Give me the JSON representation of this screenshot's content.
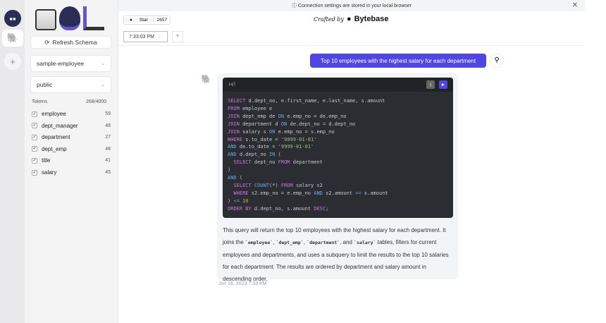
{
  "banner": {
    "text": "ⓘ Connection settings are stored in your local browser",
    "close": "✕"
  },
  "rail": {
    "add": "+"
  },
  "sidebar": {
    "logo": "SQL Chat",
    "refresh": "Refresh Schema",
    "database": "sample-employee",
    "schema": "public",
    "tokens_label": "Tokens",
    "tokens_value": "268/4000",
    "tables": [
      {
        "name": "employee",
        "tokens": "59"
      },
      {
        "name": "dept_manager",
        "tokens": "48"
      },
      {
        "name": "department",
        "tokens": "27"
      },
      {
        "name": "dept_emp",
        "tokens": "48"
      },
      {
        "name": "title",
        "tokens": "41"
      },
      {
        "name": "salary",
        "tokens": "45"
      }
    ]
  },
  "header": {
    "star": "Star",
    "star_count": "2657",
    "crafted": "Crafted by",
    "brand": "Bytebase"
  },
  "tabs": [
    {
      "label": "7:33:03 PM"
    }
  ],
  "chat": {
    "user_message": "Top 10 employees with the highest salary for each department",
    "code_lang": "sql",
    "code_lines": [
      [
        [
          "SELECT",
          "k"
        ],
        [
          " d.dept_no, e.first_name, e.last_name, s.amount",
          ""
        ]
      ],
      [
        [
          "FROM",
          "k"
        ],
        [
          " employee e",
          ""
        ]
      ],
      [
        [
          "JOIN",
          "k"
        ],
        [
          " dept_emp de ",
          ""
        ],
        [
          "ON",
          "o"
        ],
        [
          " e.emp_no = de.emp_no",
          ""
        ]
      ],
      [
        [
          "JOIN",
          "k"
        ],
        [
          " department d ",
          ""
        ],
        [
          "ON",
          "o"
        ],
        [
          " de.dept_no = d.dept_no",
          ""
        ]
      ],
      [
        [
          "JOIN",
          "k"
        ],
        [
          " salary s ",
          ""
        ],
        [
          "ON",
          "o"
        ],
        [
          " e.emp_no = s.emp_no",
          ""
        ]
      ],
      [
        [
          "WHERE",
          "k"
        ],
        [
          " s.to_date = ",
          ""
        ],
        [
          "'9999-01-01'",
          "s"
        ]
      ],
      [
        [
          "AND",
          "o"
        ],
        [
          " de.to_date = ",
          ""
        ],
        [
          "'9999-01-01'",
          "s"
        ]
      ],
      [
        [
          "AND",
          "o"
        ],
        [
          " d.dept_no ",
          ""
        ],
        [
          "IN",
          "o"
        ],
        [
          " (",
          ""
        ]
      ],
      [
        [
          "  SELECT",
          "k"
        ],
        [
          " dept_no ",
          ""
        ],
        [
          "FROM",
          "k"
        ],
        [
          " department",
          ""
        ]
      ],
      [
        [
          ")",
          ""
        ]
      ],
      [
        [
          "AND",
          "o"
        ],
        [
          " (",
          ""
        ]
      ],
      [
        [
          "  SELECT",
          "k"
        ],
        [
          " ",
          ""
        ],
        [
          "COUNT",
          "o"
        ],
        [
          "(*) ",
          ""
        ],
        [
          "FROM",
          "k"
        ],
        [
          " salary s2",
          ""
        ]
      ],
      [
        [
          "  WHERE",
          "k"
        ],
        [
          " s2.emp_no = e.emp_no ",
          ""
        ],
        [
          "AND",
          "o"
        ],
        [
          " s2.amount ",
          ""
        ],
        [
          ">=",
          "o"
        ],
        [
          " s.amount",
          ""
        ]
      ],
      [
        [
          ") ",
          ""
        ],
        [
          "<=",
          "o"
        ],
        [
          " ",
          ""
        ],
        [
          "10",
          "nm"
        ]
      ],
      [
        [
          "ORDER BY",
          "k"
        ],
        [
          " d.dept_no, s.amount ",
          ""
        ],
        [
          "DESC",
          "k"
        ],
        [
          ";",
          ""
        ]
      ]
    ],
    "explanation": [
      [
        "This query will return the top 10 employees with the highest salary for each department. It joins the ",
        ""
      ],
      [
        "`employee`",
        "c"
      ],
      [
        ", ",
        ""
      ],
      [
        "`dept_emp`",
        "c"
      ],
      [
        ", ",
        ""
      ],
      [
        "`department`",
        "c"
      ],
      [
        ", and ",
        ""
      ],
      [
        "`salary`",
        "c"
      ],
      [
        " tables, filters for current employees and departments, and uses a subquery to limit the results to the top 10 salaries for each department. The results are ordered by department and salary amount in descending order.",
        ""
      ]
    ],
    "timestamp": "Jun 16, 2023 7:33 PM"
  },
  "colors": {
    "accent": "#4f46e5",
    "code_bg": "#2b2d33"
  }
}
